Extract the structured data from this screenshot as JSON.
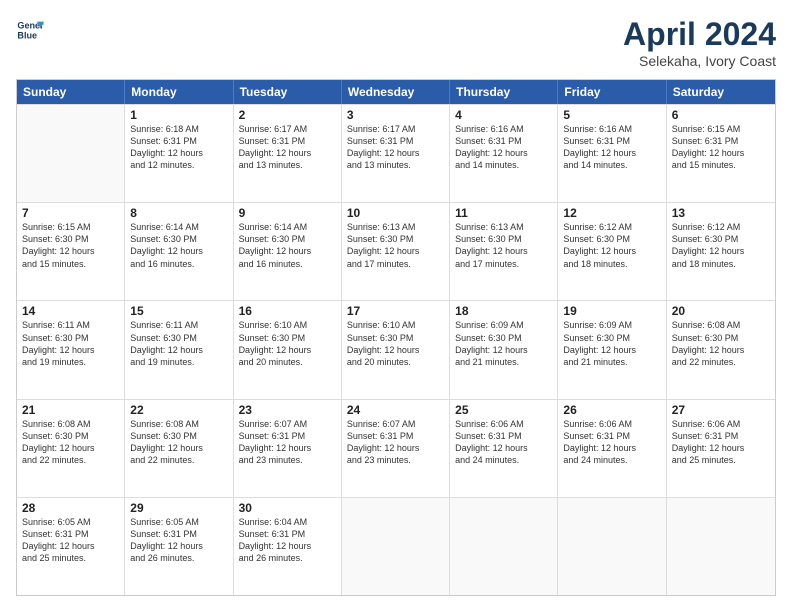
{
  "logo": {
    "line1": "General",
    "line2": "Blue"
  },
  "title": "April 2024",
  "location": "Selekaha, Ivory Coast",
  "days_of_week": [
    "Sunday",
    "Monday",
    "Tuesday",
    "Wednesday",
    "Thursday",
    "Friday",
    "Saturday"
  ],
  "weeks": [
    [
      {
        "day": "",
        "lines": []
      },
      {
        "day": "1",
        "lines": [
          "Sunrise: 6:18 AM",
          "Sunset: 6:31 PM",
          "Daylight: 12 hours",
          "and 12 minutes."
        ]
      },
      {
        "day": "2",
        "lines": [
          "Sunrise: 6:17 AM",
          "Sunset: 6:31 PM",
          "Daylight: 12 hours",
          "and 13 minutes."
        ]
      },
      {
        "day": "3",
        "lines": [
          "Sunrise: 6:17 AM",
          "Sunset: 6:31 PM",
          "Daylight: 12 hours",
          "and 13 minutes."
        ]
      },
      {
        "day": "4",
        "lines": [
          "Sunrise: 6:16 AM",
          "Sunset: 6:31 PM",
          "Daylight: 12 hours",
          "and 14 minutes."
        ]
      },
      {
        "day": "5",
        "lines": [
          "Sunrise: 6:16 AM",
          "Sunset: 6:31 PM",
          "Daylight: 12 hours",
          "and 14 minutes."
        ]
      },
      {
        "day": "6",
        "lines": [
          "Sunrise: 6:15 AM",
          "Sunset: 6:31 PM",
          "Daylight: 12 hours",
          "and 15 minutes."
        ]
      }
    ],
    [
      {
        "day": "7",
        "lines": [
          "Sunrise: 6:15 AM",
          "Sunset: 6:30 PM",
          "Daylight: 12 hours",
          "and 15 minutes."
        ]
      },
      {
        "day": "8",
        "lines": [
          "Sunrise: 6:14 AM",
          "Sunset: 6:30 PM",
          "Daylight: 12 hours",
          "and 16 minutes."
        ]
      },
      {
        "day": "9",
        "lines": [
          "Sunrise: 6:14 AM",
          "Sunset: 6:30 PM",
          "Daylight: 12 hours",
          "and 16 minutes."
        ]
      },
      {
        "day": "10",
        "lines": [
          "Sunrise: 6:13 AM",
          "Sunset: 6:30 PM",
          "Daylight: 12 hours",
          "and 17 minutes."
        ]
      },
      {
        "day": "11",
        "lines": [
          "Sunrise: 6:13 AM",
          "Sunset: 6:30 PM",
          "Daylight: 12 hours",
          "and 17 minutes."
        ]
      },
      {
        "day": "12",
        "lines": [
          "Sunrise: 6:12 AM",
          "Sunset: 6:30 PM",
          "Daylight: 12 hours",
          "and 18 minutes."
        ]
      },
      {
        "day": "13",
        "lines": [
          "Sunrise: 6:12 AM",
          "Sunset: 6:30 PM",
          "Daylight: 12 hours",
          "and 18 minutes."
        ]
      }
    ],
    [
      {
        "day": "14",
        "lines": [
          "Sunrise: 6:11 AM",
          "Sunset: 6:30 PM",
          "Daylight: 12 hours",
          "and 19 minutes."
        ]
      },
      {
        "day": "15",
        "lines": [
          "Sunrise: 6:11 AM",
          "Sunset: 6:30 PM",
          "Daylight: 12 hours",
          "and 19 minutes."
        ]
      },
      {
        "day": "16",
        "lines": [
          "Sunrise: 6:10 AM",
          "Sunset: 6:30 PM",
          "Daylight: 12 hours",
          "and 20 minutes."
        ]
      },
      {
        "day": "17",
        "lines": [
          "Sunrise: 6:10 AM",
          "Sunset: 6:30 PM",
          "Daylight: 12 hours",
          "and 20 minutes."
        ]
      },
      {
        "day": "18",
        "lines": [
          "Sunrise: 6:09 AM",
          "Sunset: 6:30 PM",
          "Daylight: 12 hours",
          "and 21 minutes."
        ]
      },
      {
        "day": "19",
        "lines": [
          "Sunrise: 6:09 AM",
          "Sunset: 6:30 PM",
          "Daylight: 12 hours",
          "and 21 minutes."
        ]
      },
      {
        "day": "20",
        "lines": [
          "Sunrise: 6:08 AM",
          "Sunset: 6:30 PM",
          "Daylight: 12 hours",
          "and 22 minutes."
        ]
      }
    ],
    [
      {
        "day": "21",
        "lines": [
          "Sunrise: 6:08 AM",
          "Sunset: 6:30 PM",
          "Daylight: 12 hours",
          "and 22 minutes."
        ]
      },
      {
        "day": "22",
        "lines": [
          "Sunrise: 6:08 AM",
          "Sunset: 6:30 PM",
          "Daylight: 12 hours",
          "and 22 minutes."
        ]
      },
      {
        "day": "23",
        "lines": [
          "Sunrise: 6:07 AM",
          "Sunset: 6:31 PM",
          "Daylight: 12 hours",
          "and 23 minutes."
        ]
      },
      {
        "day": "24",
        "lines": [
          "Sunrise: 6:07 AM",
          "Sunset: 6:31 PM",
          "Daylight: 12 hours",
          "and 23 minutes."
        ]
      },
      {
        "day": "25",
        "lines": [
          "Sunrise: 6:06 AM",
          "Sunset: 6:31 PM",
          "Daylight: 12 hours",
          "and 24 minutes."
        ]
      },
      {
        "day": "26",
        "lines": [
          "Sunrise: 6:06 AM",
          "Sunset: 6:31 PM",
          "Daylight: 12 hours",
          "and 24 minutes."
        ]
      },
      {
        "day": "27",
        "lines": [
          "Sunrise: 6:06 AM",
          "Sunset: 6:31 PM",
          "Daylight: 12 hours",
          "and 25 minutes."
        ]
      }
    ],
    [
      {
        "day": "28",
        "lines": [
          "Sunrise: 6:05 AM",
          "Sunset: 6:31 PM",
          "Daylight: 12 hours",
          "and 25 minutes."
        ]
      },
      {
        "day": "29",
        "lines": [
          "Sunrise: 6:05 AM",
          "Sunset: 6:31 PM",
          "Daylight: 12 hours",
          "and 26 minutes."
        ]
      },
      {
        "day": "30",
        "lines": [
          "Sunrise: 6:04 AM",
          "Sunset: 6:31 PM",
          "Daylight: 12 hours",
          "and 26 minutes."
        ]
      },
      {
        "day": "",
        "lines": []
      },
      {
        "day": "",
        "lines": []
      },
      {
        "day": "",
        "lines": []
      },
      {
        "day": "",
        "lines": []
      }
    ]
  ]
}
